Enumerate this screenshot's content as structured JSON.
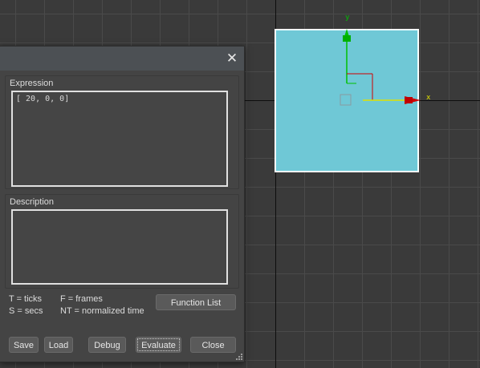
{
  "viewport": {
    "axis_x_label": "x",
    "axis_y_label": "y",
    "colors": {
      "plane": "#6fc8d6",
      "axis_x": "#e0e000",
      "axis_y": "#00c000",
      "arrow_x": "#d00000"
    }
  },
  "dialog": {
    "close_icon": "close-icon",
    "expression": {
      "label": "Expression",
      "value": "[ 20, 0, 0]"
    },
    "description": {
      "label": "Description",
      "value": ""
    },
    "help": {
      "t": "T = ticks",
      "s": "S = secs",
      "f": "F = frames",
      "nt": "NT = normalized time"
    },
    "buttons": {
      "function_list": "Function List",
      "save": "Save",
      "load": "Load",
      "debug": "Debug",
      "evaluate": "Evaluate",
      "close": "Close"
    }
  }
}
